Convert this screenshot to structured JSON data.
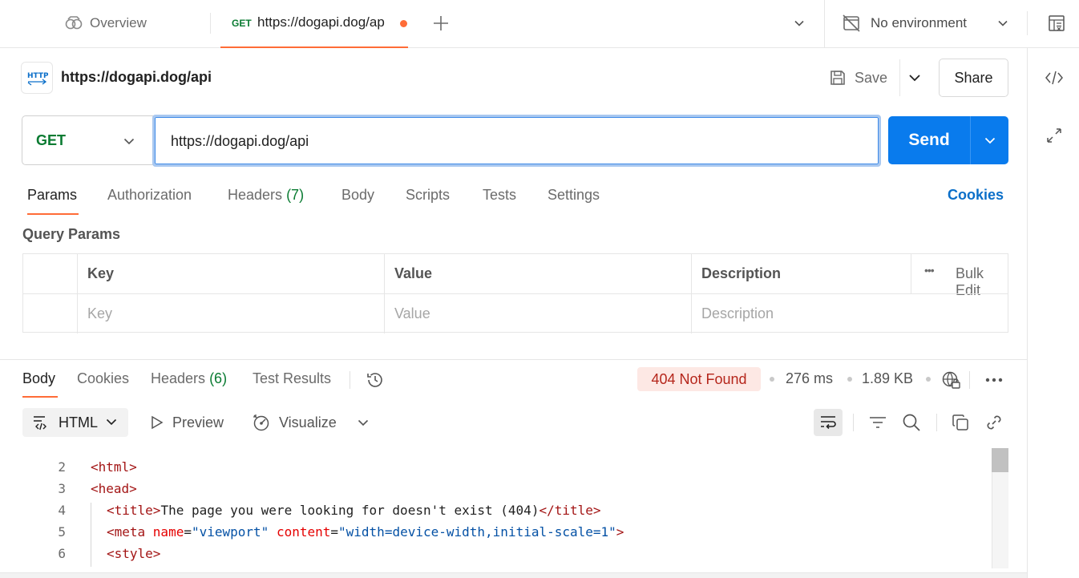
{
  "tabs": {
    "overview_label": "Overview",
    "active": {
      "method": "GET",
      "url": "https://dogapi.dog/ap"
    }
  },
  "environment": {
    "label": "No environment"
  },
  "request": {
    "title": "https://dogapi.dog/api",
    "save_label": "Save",
    "share_label": "Share",
    "method": "GET",
    "url": "https://dogapi.dog/api",
    "send_label": "Send"
  },
  "request_tabs": {
    "params": "Params",
    "authorization": "Authorization",
    "headers": "Headers",
    "headers_count": "(7)",
    "body": "Body",
    "scripts": "Scripts",
    "tests": "Tests",
    "settings": "Settings",
    "cookies": "Cookies"
  },
  "query_params": {
    "title": "Query Params",
    "columns": {
      "key": "Key",
      "value": "Value",
      "description": "Description"
    },
    "bulk_edit": "Bulk Edit",
    "placeholders": {
      "key": "Key",
      "value": "Value",
      "description": "Description"
    }
  },
  "response": {
    "tabs": {
      "body": "Body",
      "cookies": "Cookies",
      "headers": "Headers",
      "headers_count": "(6)",
      "test_results": "Test Results"
    },
    "status": "404 Not Found",
    "time": "276 ms",
    "size": "1.89 KB",
    "format": "HTML",
    "preview": "Preview",
    "visualize": "Visualize",
    "code": [
      {
        "n": "2",
        "parts": [
          [
            "tag",
            "<html>"
          ]
        ]
      },
      {
        "n": "3",
        "parts": [
          [
            "tag",
            "<head>"
          ]
        ]
      },
      {
        "n": "4",
        "parts": [
          [
            "tag",
            "<title>"
          ],
          [
            "txt",
            "The page you were looking for doesn't exist (404)"
          ],
          [
            "tag",
            "</title>"
          ]
        ]
      },
      {
        "n": "5",
        "parts": [
          [
            "tag",
            "<meta "
          ],
          [
            "attr",
            "name"
          ],
          [
            "txt",
            "="
          ],
          [
            "val",
            "\"viewport\""
          ],
          [
            "txt",
            " "
          ],
          [
            "attr",
            "content"
          ],
          [
            "txt",
            "="
          ],
          [
            "val",
            "\"width=device-width,initial-scale=1\""
          ],
          [
            "tag",
            ">"
          ]
        ]
      },
      {
        "n": "6",
        "parts": [
          [
            "tag",
            "<style>"
          ]
        ]
      }
    ]
  },
  "colors": {
    "accent": "#ff6c37",
    "send": "#097bed",
    "get_method": "#0a7b32",
    "error_text": "#b5261b",
    "error_bg": "#fde8e4"
  }
}
